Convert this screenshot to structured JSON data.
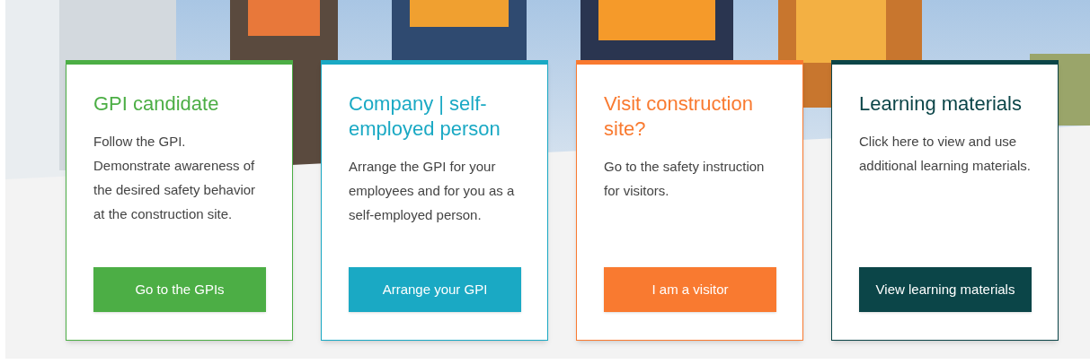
{
  "cards": [
    {
      "title": "GPI candidate",
      "description": "Follow the GPI. Demonstrate awareness of the desired safety behavior at the construction site.",
      "button": "Go to the GPIs",
      "color": "#4cae45"
    },
    {
      "title": "Company | self-employed person",
      "description": "Arrange the GPI for your employees and for you as a self-employed person.",
      "button": "Arrange your GPI",
      "color": "#1aa9c4"
    },
    {
      "title": "Visit construction site?",
      "description": "Go to the safety instruction for visitors.",
      "button": "I am a visitor",
      "color": "#f97a30"
    },
    {
      "title": "Learning materials",
      "description": "Click here to view and use additional learning materials.",
      "button": "View learning materials",
      "color": "#0b4548"
    }
  ]
}
